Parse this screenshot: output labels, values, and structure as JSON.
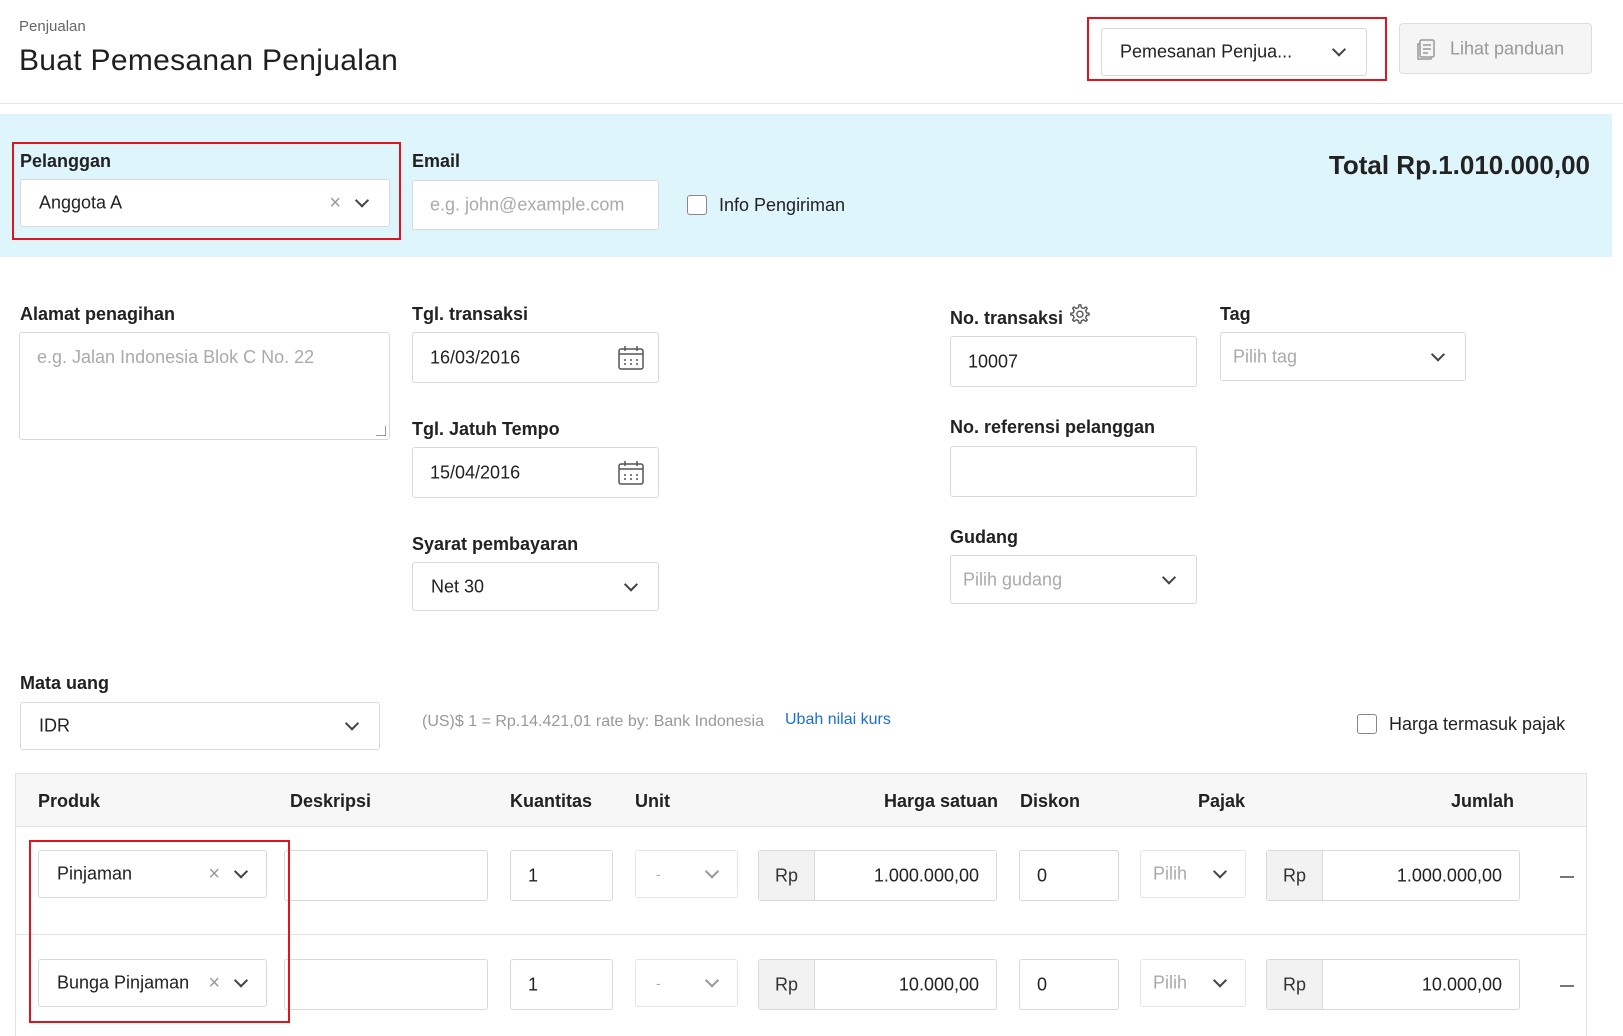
{
  "header": {
    "breadcrumb": "Penjualan",
    "title": "Buat Pemesanan Penjualan",
    "doc_type_select": "Pemesanan Penjua...",
    "guide_button": "Lihat panduan"
  },
  "customer": {
    "label": "Pelanggan",
    "value": "Anggota A",
    "email_label": "Email",
    "email_placeholder": "e.g. john@example.com",
    "shipping_label": "Info Pengiriman",
    "shipping_checked": false,
    "total": "Total Rp.1.010.000,00"
  },
  "form": {
    "billing_label": "Alamat penagihan",
    "billing_placeholder": "e.g. Jalan Indonesia Blok C No. 22",
    "trx_date_label": "Tgl. transaksi",
    "trx_date": "16/03/2016",
    "due_date_label": "Tgl. Jatuh Tempo",
    "due_date": "15/04/2016",
    "terms_label": "Syarat pembayaran",
    "terms": "Net 30",
    "trx_no_label": "No. transaksi",
    "trx_no": "10007",
    "ref_label": "No. referensi pelanggan",
    "ref_value": "",
    "warehouse_label": "Gudang",
    "warehouse_placeholder": "Pilih gudang",
    "tag_label": "Tag",
    "tag_placeholder": "Pilih tag",
    "currency_label": "Mata uang",
    "currency": "IDR",
    "rate_text": "(US)$ 1 = Rp.14.421,01 rate by: Bank Indonesia",
    "rate_link": "Ubah nilai kurs",
    "tax_inclusive_label": "Harga termasuk pajak",
    "tax_inclusive_checked": false
  },
  "table": {
    "headers": {
      "product": "Produk",
      "description": "Deskripsi",
      "quantity": "Kuantitas",
      "unit": "Unit",
      "unit_price": "Harga satuan",
      "discount": "Diskon",
      "tax": "Pajak",
      "amount": "Jumlah"
    },
    "currency_prefix": "Rp",
    "rows": [
      {
        "product": "Pinjaman",
        "description": "",
        "quantity": "1",
        "unit": "-",
        "unit_price": "1.000.000,00",
        "discount": "0",
        "tax": "Pilih",
        "amount": "1.000.000,00"
      },
      {
        "product": "Bunga Pinjaman",
        "description": "",
        "quantity": "1",
        "unit": "-",
        "unit_price": "10.000,00",
        "discount": "0",
        "tax": "Pilih",
        "amount": "10.000,00"
      }
    ]
  },
  "colors": {
    "accent_band": "#dff5fc",
    "highlight_border": "#e0141e",
    "link": "#1a6fd4"
  }
}
